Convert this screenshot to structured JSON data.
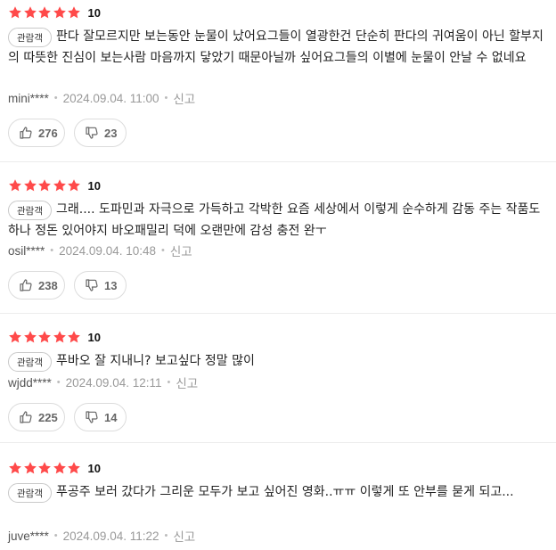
{
  "colors": {
    "star": "#ff4a4a",
    "divider": "#ececec",
    "meta": "#999999"
  },
  "icons": {
    "star": "star-icon",
    "like": "thumbs-up-icon",
    "dislike": "thumbs-down-icon"
  },
  "reviews": [
    {
      "rating": "10",
      "stars": 5,
      "badge": "관람객",
      "text": "판다 잘모르지만 보는동안 눈물이 났어요그들이 열광한건 단순히 판다의 귀여움이 아닌 할부지의 따뜻한 진심이 보는사람 마음까지 닿았기 때문아닐까 싶어요그들의 이별에 눈물이 안날 수 없네요",
      "user": "mini****",
      "date": "2024.09.04. 11:00",
      "report": "신고",
      "likes": "276",
      "dislikes": "23"
    },
    {
      "rating": "10",
      "stars": 5,
      "badge": "관람객",
      "text": "그래.... 도파민과 자극으로 가득하고 각박한 요즘 세상에서 이렇게 순수하게 감동 주는 작품도 하나 정돈 있어야지 바오패밀리 덕에 오랜만에 감성 충전 완ㅜ",
      "user": "osil****",
      "date": "2024.09.04. 10:48",
      "report": "신고",
      "likes": "238",
      "dislikes": "13"
    },
    {
      "rating": "10",
      "stars": 5,
      "badge": "관람객",
      "text": "푸바오 잘 지내니? 보고싶다 정말 많이",
      "user": "wjdd****",
      "date": "2024.09.04. 12:11",
      "report": "신고",
      "likes": "225",
      "dislikes": "14"
    },
    {
      "rating": "10",
      "stars": 5,
      "badge": "관람객",
      "text": "푸공주 보러 갔다가 그리운 모두가 보고 싶어진 영화..ㅠㅠ 이렇게 또 안부를 묻게 되고...",
      "user": "juve****",
      "date": "2024.09.04. 11:22",
      "report": "신고"
    }
  ]
}
